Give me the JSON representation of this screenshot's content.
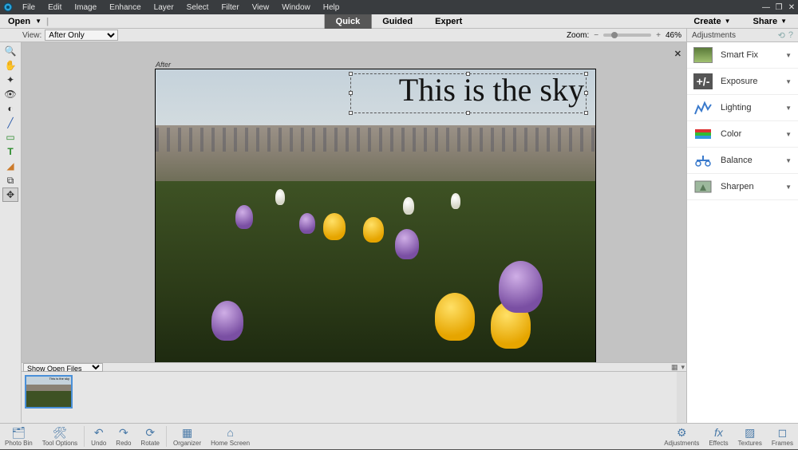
{
  "menu": {
    "items": [
      "File",
      "Edit",
      "Image",
      "Enhance",
      "Layer",
      "Select",
      "Filter",
      "View",
      "Window",
      "Help"
    ]
  },
  "secondbar": {
    "open": "Open",
    "modes": [
      "Quick",
      "Guided",
      "Expert"
    ],
    "active_mode": "Quick",
    "create": "Create",
    "share": "Share"
  },
  "subbar": {
    "view_label": "View:",
    "view_value": "After Only",
    "zoom_label": "Zoom:",
    "zoom_pct": "46%",
    "adjustments_label": "Adjustments"
  },
  "canvas": {
    "after_label": "After",
    "overlay_text": "This is the sky"
  },
  "adjustments": [
    {
      "name": "Smart Fix"
    },
    {
      "name": "Exposure"
    },
    {
      "name": "Lighting"
    },
    {
      "name": "Color"
    },
    {
      "name": "Balance"
    },
    {
      "name": "Sharpen"
    }
  ],
  "photobin": {
    "select_label": "Show Open Files",
    "thumb_text": "This is the sky"
  },
  "bottombar": {
    "left": [
      "Photo Bin",
      "Tool Options",
      "Undo",
      "Redo",
      "Rotate",
      "Organizer",
      "Home Screen"
    ],
    "right": [
      "Adjustments",
      "Effects",
      "Textures",
      "Frames"
    ]
  }
}
